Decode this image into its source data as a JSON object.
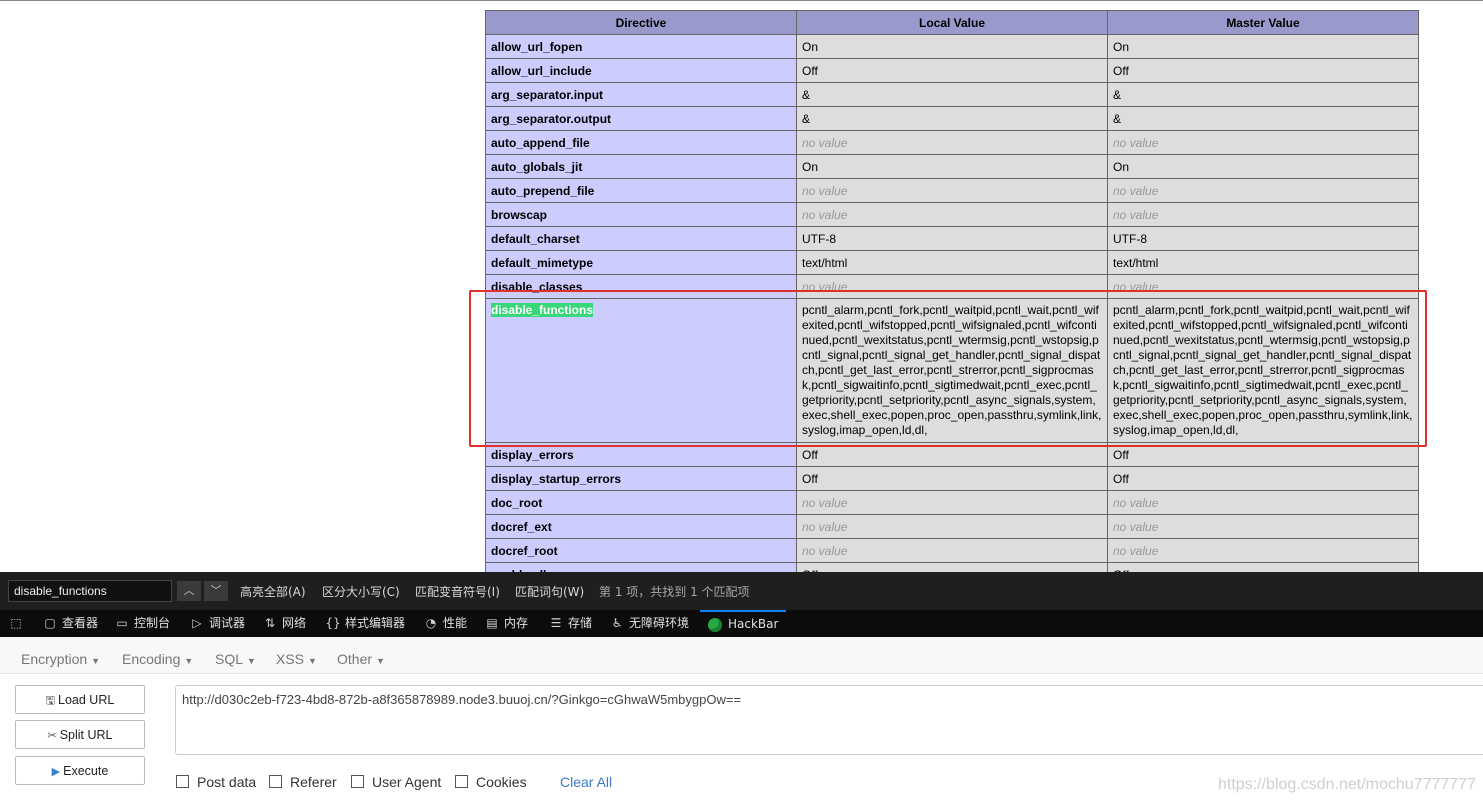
{
  "phpinfo": {
    "headers": [
      "Directive",
      "Local Value",
      "Master Value"
    ],
    "rows": [
      {
        "directive": "allow_url_fopen",
        "local": "On",
        "master": "On"
      },
      {
        "directive": "allow_url_include",
        "local": "Off",
        "master": "Off"
      },
      {
        "directive": "arg_separator.input",
        "local": "&",
        "master": "&"
      },
      {
        "directive": "arg_separator.output",
        "local": "&",
        "master": "&"
      },
      {
        "directive": "auto_append_file",
        "local": "no value",
        "master": "no value",
        "novalue": true
      },
      {
        "directive": "auto_globals_jit",
        "local": "On",
        "master": "On"
      },
      {
        "directive": "auto_prepend_file",
        "local": "no value",
        "master": "no value",
        "novalue": true
      },
      {
        "directive": "browscap",
        "local": "no value",
        "master": "no value",
        "novalue": true
      },
      {
        "directive": "default_charset",
        "local": "UTF-8",
        "master": "UTF-8"
      },
      {
        "directive": "default_mimetype",
        "local": "text/html",
        "master": "text/html"
      },
      {
        "directive": "disable_classes",
        "local": "no value",
        "master": "no value",
        "novalue": true
      },
      {
        "directive": "disable_functions",
        "local": "pcntl_alarm,pcntl_fork,pcntl_waitpid,pcntl_wait,pcntl_wifexited,pcntl_wifstopped,pcntl_wifsignaled,pcntl_wifcontinued,pcntl_wexitstatus,pcntl_wtermsig,pcntl_wstopsig,pcntl_signal,pcntl_signal_get_handler,pcntl_signal_dispatch,pcntl_get_last_error,pcntl_strerror,pcntl_sigprocmask,pcntl_sigwaitinfo,pcntl_sigtimedwait,pcntl_exec,pcntl_getpriority,pcntl_setpriority,pcntl_async_signals,system,exec,shell_exec,popen,proc_open,passthru,symlink,link,syslog,imap_open,ld,dl,",
        "master": "pcntl_alarm,pcntl_fork,pcntl_waitpid,pcntl_wait,pcntl_wifexited,pcntl_wifstopped,pcntl_wifsignaled,pcntl_wifcontinued,pcntl_wexitstatus,pcntl_wtermsig,pcntl_wstopsig,pcntl_signal,pcntl_signal_get_handler,pcntl_signal_dispatch,pcntl_get_last_error,pcntl_strerror,pcntl_sigprocmask,pcntl_sigwaitinfo,pcntl_sigtimedwait,pcntl_exec,pcntl_getpriority,pcntl_setpriority,pcntl_async_signals,system,exec,shell_exec,popen,proc_open,passthru,symlink,link,syslog,imap_open,ld,dl,",
        "highlight": true
      },
      {
        "directive": "display_errors",
        "local": "Off",
        "master": "Off"
      },
      {
        "directive": "display_startup_errors",
        "local": "Off",
        "master": "Off"
      },
      {
        "directive": "doc_root",
        "local": "no value",
        "master": "no value",
        "novalue": true
      },
      {
        "directive": "docref_ext",
        "local": "no value",
        "master": "no value",
        "novalue": true
      },
      {
        "directive": "docref_root",
        "local": "no value",
        "master": "no value",
        "novalue": true
      },
      {
        "directive": "enable_dl",
        "local": "Off",
        "master": "Off"
      }
    ]
  },
  "findbar": {
    "query": "disable_functions",
    "prev_icon": "chevron-up-icon",
    "next_icon": "chevron-down-icon",
    "highlight_all": "高亮全部(A)",
    "match_case": "区分大小写(C)",
    "match_diacritics": "匹配变音符号(I)",
    "whole_words": "匹配词句(W)",
    "status": "第 1 项，共找到 1 个匹配项"
  },
  "devtools": {
    "tabs": [
      {
        "label": "查看器",
        "icon": "inspector-icon"
      },
      {
        "label": "控制台",
        "icon": "console-icon"
      },
      {
        "label": "调试器",
        "icon": "debugger-icon"
      },
      {
        "label": "网络",
        "icon": "network-icon"
      },
      {
        "label": "样式编辑器",
        "icon": "style-editor-icon"
      },
      {
        "label": "性能",
        "icon": "performance-icon"
      },
      {
        "label": "内存",
        "icon": "memory-icon"
      },
      {
        "label": "存储",
        "icon": "storage-icon"
      },
      {
        "label": "无障碍环境",
        "icon": "accessibility-icon"
      },
      {
        "label": "HackBar",
        "icon": "hackbar-icon",
        "active": true
      }
    ]
  },
  "hackbar": {
    "menu": [
      "Encryption",
      "Encoding",
      "SQL",
      "XSS",
      "Other"
    ],
    "load_url": "Load URL",
    "split_url": "Split URL",
    "execute": "Execute",
    "url": "http://d030c2eb-f723-4bd8-872b-a8f365878989.node3.buuoj.cn/?Ginkgo=cGhwaW5mbygpOw==",
    "checkboxes": [
      "Post data",
      "Referer",
      "User Agent",
      "Cookies"
    ],
    "clear_all": "Clear All"
  },
  "watermark": "https://blog.csdn.net/mochu7777777"
}
